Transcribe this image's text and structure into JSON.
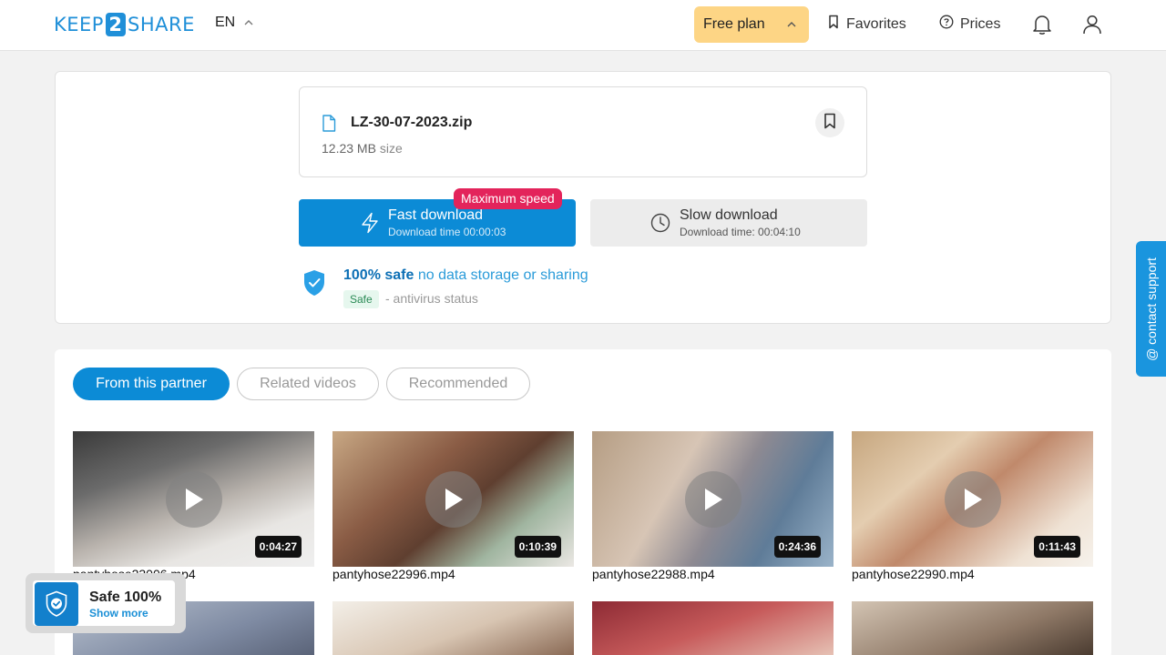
{
  "header": {
    "logo_left": "KEEP",
    "logo_num": "2",
    "logo_right": "SHARE",
    "language": "EN",
    "plan_label": "Free plan",
    "favorites_label": "Favorites",
    "prices_label": "Prices"
  },
  "file": {
    "name": "LZ-30-07-2023.zip",
    "size": "12.23 MB",
    "size_suffix": "size"
  },
  "download": {
    "badge": "Maximum speed",
    "fast_title": "Fast download",
    "fast_sub": "Download time 00:00:03",
    "slow_title": "Slow download",
    "slow_sub": "Download time: 00:04:10"
  },
  "safety": {
    "bold": "100% safe",
    "light": "no data storage or sharing",
    "chip": "Safe",
    "status": "- antivirus status"
  },
  "tabs": [
    "From this partner",
    "Related videos",
    "Recommended"
  ],
  "videos": [
    {
      "name": "pantyhose23006.mp4",
      "duration": "0:04:27"
    },
    {
      "name": "pantyhose22996.mp4",
      "duration": "0:10:39"
    },
    {
      "name": "pantyhose22988.mp4",
      "duration": "0:24:36"
    },
    {
      "name": "pantyhose22990.mp4",
      "duration": "0:11:43"
    }
  ],
  "contact_support": "@ contact support",
  "safe_widget": {
    "title": "Safe 100%",
    "link": "Show more"
  },
  "colors": {
    "brand_blue": "#1f8fd8",
    "fast_button": "#0c8bd6",
    "plan_button": "#fdd585",
    "badge_red": "#e3245b"
  }
}
